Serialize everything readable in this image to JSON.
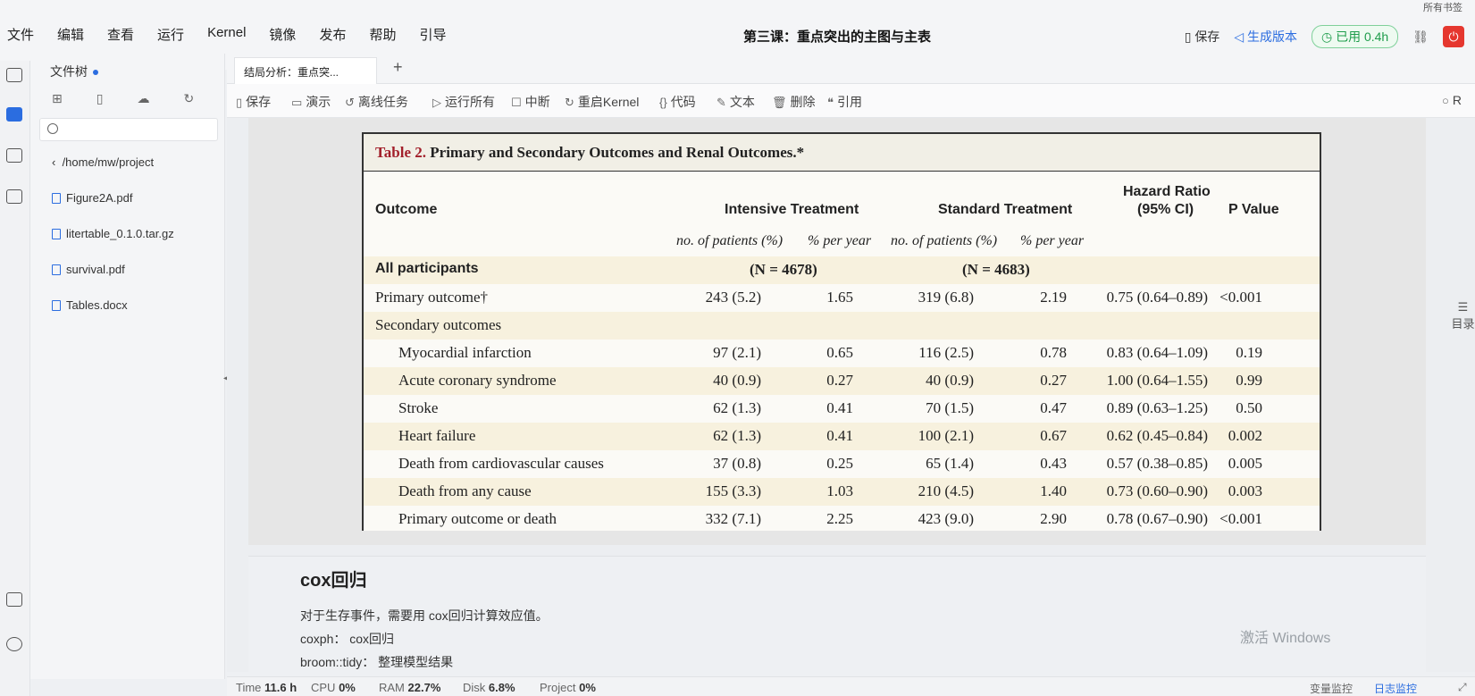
{
  "menubar": {
    "items": [
      "文件",
      "编辑",
      "查看",
      "运行",
      "Kernel",
      "镜像",
      "发布",
      "帮助",
      "引导"
    ],
    "doc_title": "第三课：重点突出的主图与主表",
    "save_label": "保存",
    "gen_version_label": "生成版本",
    "used_label": "已用 0.4h",
    "corner_note": "所有书签",
    "colors": {
      "accent": "#2b6de0",
      "used_green": "#1f9d4c",
      "power_red": "#e5372f"
    }
  },
  "rail": {
    "icons": [
      "inbox-icon",
      "folder-icon",
      "database-icon",
      "terminal-icon",
      "help-icon",
      "theme-icon"
    ]
  },
  "filepanel": {
    "title": "文件树",
    "path": "/home/mw/project",
    "files": [
      "Figure2A.pdf",
      "litertable_0.1.0.tar.gz",
      "survival.pdf",
      "Tables.docx"
    ]
  },
  "tabs": {
    "active_tab": "结局分析：重点突..."
  },
  "toolbar": {
    "save": "保存",
    "present": "演示",
    "offline": "离线任务",
    "run_all": "运行所有",
    "interrupt": "中断",
    "restart": "重启Kernel",
    "code": "代码",
    "text": "文本",
    "delete": "删除",
    "cite": "引用",
    "mode": "R"
  },
  "table": {
    "label": "Table 2.",
    "title": "Primary and Secondary Outcomes and Renal Outcomes.*",
    "headers": {
      "outcome": "Outcome",
      "intensive": "Intensive Treatment",
      "standard": "Standard Treatment",
      "hr_line1": "Hazard Ratio",
      "hr_line2": "(95% CI)",
      "p": "P Value",
      "sub_np": "no. of patients (%)",
      "sub_py": "% per year"
    },
    "all_participants": {
      "label": "All participants",
      "n_int": "(N = 4678)",
      "n_std": "(N = 4683)"
    },
    "rows": [
      {
        "outcome": "Primary outcome†",
        "int_n": "243 (5.2)",
        "int_py": "1.65",
        "std_n": "319 (6.8)",
        "std_py": "2.19",
        "hr": "0.75 (0.64–0.89)",
        "p": "<0.001"
      },
      {
        "outcome": "Secondary outcomes",
        "int_n": "",
        "int_py": "",
        "std_n": "",
        "std_py": "",
        "hr": "",
        "p": ""
      },
      {
        "outcome": "Myocardial infarction",
        "int_n": "97 (2.1)",
        "int_py": "0.65",
        "std_n": "116 (2.5)",
        "std_py": "0.78",
        "hr": "0.83 (0.64–1.09)",
        "p": "0.19"
      },
      {
        "outcome": "Acute coronary syndrome",
        "int_n": "40 (0.9)",
        "int_py": "0.27",
        "std_n": "40 (0.9)",
        "std_py": "0.27",
        "hr": "1.00 (0.64–1.55)",
        "p": "0.99"
      },
      {
        "outcome": "Stroke",
        "int_n": "62 (1.3)",
        "int_py": "0.41",
        "std_n": "70 (1.5)",
        "std_py": "0.47",
        "hr": "0.89 (0.63–1.25)",
        "p": "0.50"
      },
      {
        "outcome": "Heart failure",
        "int_n": "62 (1.3)",
        "int_py": "0.41",
        "std_n": "100 (2.1)",
        "std_py": "0.67",
        "hr": "0.62 (0.45–0.84)",
        "p": "0.002"
      },
      {
        "outcome": "Death from cardiovascular causes",
        "int_n": "37 (0.8)",
        "int_py": "0.25",
        "std_n": "65 (1.4)",
        "std_py": "0.43",
        "hr": "0.57 (0.38–0.85)",
        "p": "0.005"
      },
      {
        "outcome": "Death from any cause",
        "int_n": "155 (3.3)",
        "int_py": "1.03",
        "std_n": "210 (4.5)",
        "std_py": "1.40",
        "hr": "0.73 (0.60–0.90)",
        "p": "0.003"
      },
      {
        "outcome": "Primary outcome or death",
        "int_n": "332 (7.1)",
        "int_py": "2.25",
        "std_n": "423 (9.0)",
        "std_py": "2.90",
        "hr": "0.78 (0.67–0.90)",
        "p": "<0.001"
      }
    ]
  },
  "markdown": {
    "heading": "cox回归",
    "line1": "对于生存事件，需要用 cox回归计算效应值。",
    "line2": "coxph：  cox回归",
    "line3": "broom::tidy：  整理模型结果"
  },
  "statusbar": {
    "time_label": "Time",
    "time_val": "11.6 h",
    "cpu_label": "CPU",
    "cpu_val": "0%",
    "ram_label": "RAM",
    "ram_val": "22.7%",
    "disk_label": "Disk",
    "disk_val": "6.8%",
    "project_label": "Project",
    "project_val": "0%",
    "var_monitor": "变量监控",
    "log_monitor": "日志监控",
    "windows_note": "激活 Windows"
  },
  "right_toc": "目录"
}
